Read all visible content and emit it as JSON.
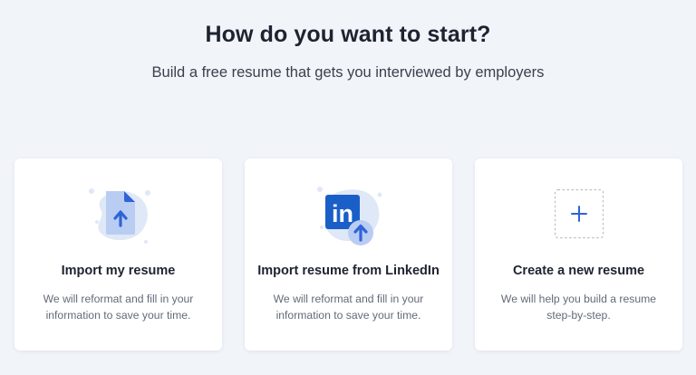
{
  "header": {
    "title": "How do you want to start?",
    "subtitle": "Build a free resume that gets you interviewed by employers"
  },
  "cards": [
    {
      "title": "Import my resume",
      "description": "We will reformat and fill in your information to save your time.",
      "icon": "upload-document-icon"
    },
    {
      "title": "Import resume from LinkedIn",
      "description": "We will reformat and fill in your information to save your time.",
      "icon": "linkedin-upload-icon",
      "logo_text": "in"
    },
    {
      "title": "Create a new resume",
      "description": "We will help you build a resume step-by-step.",
      "icon": "plus-icon"
    }
  ],
  "colors": {
    "page_background": "#f1f4f9",
    "card_background": "#ffffff",
    "accent_blue": "#2f63d8",
    "linkedin_blue": "#1a5fc8",
    "blob_blue": "#dfe8f7",
    "title_text": "#1e2330",
    "body_text": "#626a78"
  }
}
